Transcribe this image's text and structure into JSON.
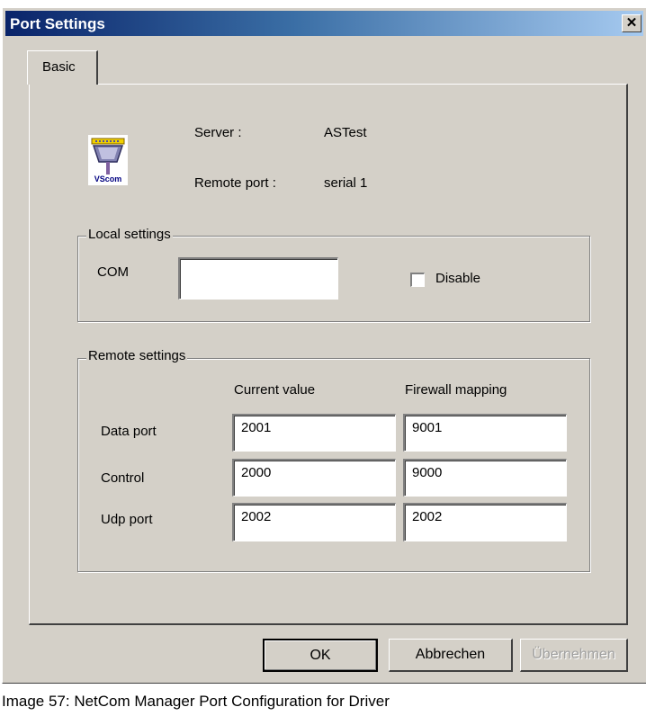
{
  "window": {
    "title": "Port Settings",
    "close_glyph": "✕"
  },
  "tabs": [
    {
      "label": "Basic"
    }
  ],
  "info": {
    "server_label": "Server :",
    "server_value": "ASTest",
    "remote_port_label": "Remote port :",
    "remote_port_value": "serial 1",
    "icon_text": "VScom",
    "icon_name": "serial-port-icon"
  },
  "local_settings": {
    "legend": "Local settings",
    "com_label": "COM",
    "com_value": "",
    "disable_label": "Disable",
    "disable_checked": false
  },
  "remote_settings": {
    "legend": "Remote settings",
    "col_current": "Current value",
    "col_firewall": "Firewall mapping",
    "rows": [
      {
        "label": "Data port",
        "current": "2001",
        "firewall": "9001"
      },
      {
        "label": "Control",
        "current": "2000",
        "firewall": "9000"
      },
      {
        "label": "Udp port",
        "current": "2002",
        "firewall": "2002"
      }
    ]
  },
  "buttons": {
    "ok": "OK",
    "cancel": "Abbrechen",
    "apply": "Übernehmen"
  },
  "caption": "Image 57: NetCom Manager Port Configuration for Driver"
}
